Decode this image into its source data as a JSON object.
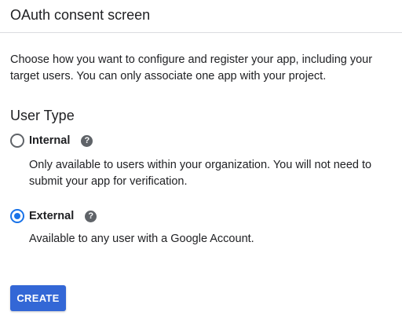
{
  "header": {
    "title": "OAuth consent screen"
  },
  "intro": {
    "text": "Choose how you want to configure and register your app, including your target users. You can only associate one app with your project."
  },
  "user_type": {
    "title": "User Type",
    "options": [
      {
        "label": "Internal",
        "description": "Only available to users within your organization. You will not need to submit your app for verification.",
        "selected": false,
        "help_icon": "help-circle-icon"
      },
      {
        "label": "External",
        "description": "Available to any user with a Google Account.",
        "selected": true,
        "help_icon": "help-circle-icon"
      }
    ]
  },
  "actions": {
    "create_label": "CREATE"
  },
  "colors": {
    "accent": "#1a73e8",
    "button": "#3367d6",
    "text": "#202124",
    "icon": "#5f6368",
    "divider": "#dadce0"
  }
}
